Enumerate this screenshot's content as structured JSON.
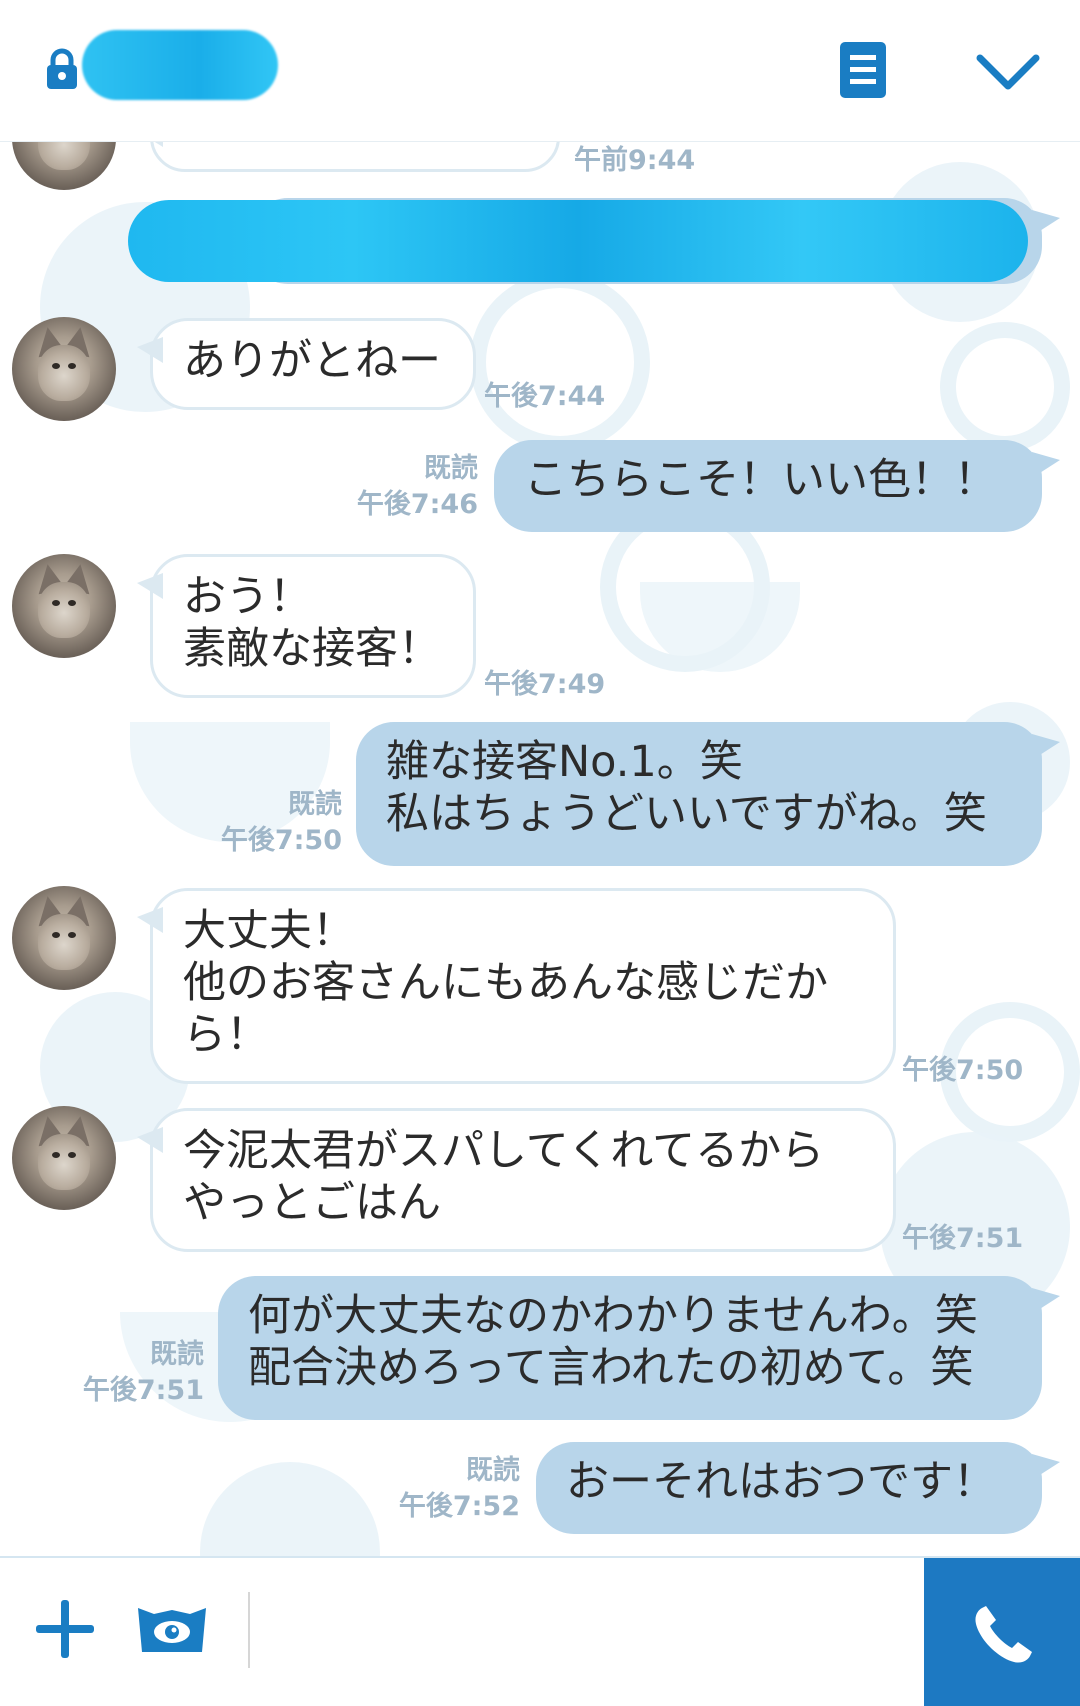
{
  "header": {
    "lock_icon": "lock-icon",
    "menu_icon": "document-list-icon",
    "chevron_icon": "chevron-down-icon",
    "colors": {
      "accent": "#1a7dc3"
    }
  },
  "chat": {
    "top_partial_time": "午前9:44",
    "messages": [
      {
        "from": "them",
        "text": "ありがとねー",
        "time": "午後7:44"
      },
      {
        "from": "me",
        "text": "こちらこそ！いい色！！",
        "read": "既読",
        "time": "午後7:46"
      },
      {
        "from": "them",
        "text": "おう！\n素敵な接客！",
        "time": "午後7:49"
      },
      {
        "from": "me",
        "text": "雑な接客No.1。笑\n私はちょうどいいですがね。笑",
        "read": "既読",
        "time": "午後7:50"
      },
      {
        "from": "them",
        "text": "大丈夫！\n他のお客さんにもあんな感じだか\nら！",
        "time": "午後7:50"
      },
      {
        "from": "them",
        "text": "今泥太君がスパしてくれてるから\nやっとごはん",
        "time": "午後7:51"
      },
      {
        "from": "me",
        "text": "何が大丈夫なのかわかりませんわ。笑\n配合決めろって言われたの初めて。笑",
        "read": "既読",
        "time": "午後7:51"
      },
      {
        "from": "me",
        "text": "おーそれはおつです！",
        "read": "既読",
        "time": "午後7:52"
      }
    ]
  },
  "input_bar": {
    "plus_icon": "plus-icon",
    "sticker_icon": "monster-sticker-icon",
    "call_icon": "phone-icon",
    "colors": {
      "call_bg": "#1d79c2"
    }
  }
}
